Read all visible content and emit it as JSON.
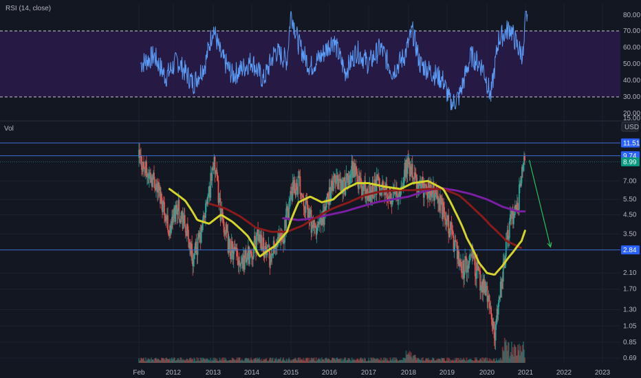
{
  "rsi_title": "RSI (14, close)",
  "vol_title": "Vol",
  "currency": "USD",
  "x_ticks": [
    "Feb",
    "2012",
    "2013",
    "2014",
    "2015",
    "2016",
    "2017",
    "2018",
    "2019",
    "2020",
    "2021",
    "2022",
    "2023"
  ],
  "colors": {
    "background": "#131722",
    "rsi_line": "#5b9cf6",
    "rsi_band": "#2a1a4a",
    "yellow_ma": "#d4d42b",
    "red_ma": "#8b1a1a",
    "purple_ma": "#7a1fa2",
    "level_line": "#3d6fd6",
    "arrow": "#22c55e",
    "candle_up": "#26a69a",
    "candle_down": "#ef5350"
  },
  "chart_data": [
    {
      "type": "line",
      "name": "RSI",
      "title": "RSI (14, close)",
      "ylim": [
        15,
        85
      ],
      "y_ticks": [
        80,
        70,
        60,
        50,
        40,
        30,
        20,
        15
      ],
      "bands": {
        "upper": 70,
        "lower": 30
      },
      "x": [
        2011.15,
        2011.5,
        2011.8,
        2012.1,
        2012.5,
        2012.8,
        2013.0,
        2013.2,
        2013.5,
        2013.8,
        2014.0,
        2014.3,
        2014.6,
        2014.9,
        2015.0,
        2015.2,
        2015.5,
        2015.8,
        2016.1,
        2016.4,
        2016.7,
        2017.0,
        2017.3,
        2017.6,
        2017.9,
        2018.1,
        2018.3,
        2018.6,
        2018.9,
        2019.1,
        2019.3,
        2019.6,
        2019.9,
        2020.1,
        2020.3,
        2020.6,
        2020.8,
        2020.95,
        2021.0,
        2021.05
      ],
      "values": [
        50,
        55,
        42,
        52,
        38,
        50,
        72,
        55,
        43,
        48,
        52,
        40,
        58,
        52,
        82,
        62,
        48,
        55,
        65,
        45,
        58,
        50,
        60,
        45,
        55,
        70,
        50,
        45,
        40,
        25,
        30,
        55,
        48,
        30,
        65,
        72,
        60,
        55,
        78,
        80
      ]
    },
    {
      "type": "line",
      "name": "Price",
      "title": "Vol",
      "yscale": "log",
      "ylim": [
        0.65,
        12.5
      ],
      "y_ticks": [
        11.51,
        9.74,
        8.99,
        7.0,
        5.5,
        4.5,
        3.5,
        2.84,
        2.1,
        1.7,
        1.3,
        1.05,
        0.85,
        0.69
      ],
      "price_tags": [
        {
          "value": 11.51,
          "label": "11.51",
          "color": "#2962ff"
        },
        {
          "value": 9.74,
          "label": "9.74",
          "color": "#2962ff"
        },
        {
          "value": 8.99,
          "label": "8.99",
          "color": "#089981"
        },
        {
          "value": 2.84,
          "label": "2.84",
          "color": "#2962ff"
        }
      ],
      "horizontal_levels": [
        11.51,
        9.74,
        2.84
      ],
      "series": [
        {
          "role": "candles",
          "x": [
            2011.1,
            2011.3,
            2011.5,
            2011.7,
            2011.9,
            2012.1,
            2012.3,
            2012.5,
            2012.7,
            2012.9,
            2013.0,
            2013.2,
            2013.4,
            2013.6,
            2013.8,
            2014.0,
            2014.2,
            2014.4,
            2014.6,
            2014.8,
            2015.0,
            2015.2,
            2015.4,
            2015.6,
            2015.8,
            2016.0,
            2016.2,
            2016.4,
            2016.6,
            2016.8,
            2017.0,
            2017.2,
            2017.4,
            2017.6,
            2017.8,
            2018.0,
            2018.2,
            2018.4,
            2018.6,
            2018.8,
            2019.0,
            2019.2,
            2019.4,
            2019.6,
            2019.8,
            2020.0,
            2020.2,
            2020.4,
            2020.6,
            2020.8,
            2021.0
          ],
          "values": [
            9.5,
            7.8,
            7.2,
            5.5,
            3.5,
            5.2,
            3.8,
            2.5,
            3.5,
            6.0,
            9.0,
            4.5,
            3.0,
            2.6,
            2.5,
            2.8,
            3.5,
            2.6,
            2.9,
            3.3,
            5.8,
            7.0,
            5.0,
            3.6,
            4.0,
            6.0,
            7.2,
            6.5,
            8.5,
            6.5,
            6.0,
            6.8,
            6.2,
            5.8,
            6.5,
            9.0,
            6.5,
            6.5,
            6.2,
            5.2,
            4.2,
            3.0,
            2.2,
            2.6,
            2.0,
            1.6,
            0.9,
            2.0,
            4.0,
            5.0,
            10.0
          ]
        },
        {
          "role": "ma-yellow",
          "x": [
            2011.9,
            2012.3,
            2012.6,
            2012.9,
            2013.2,
            2013.5,
            2013.9,
            2014.2,
            2014.6,
            2014.9,
            2015.2,
            2015.5,
            2015.8,
            2016.1,
            2016.4,
            2016.7,
            2017.0,
            2017.4,
            2017.8,
            2018.1,
            2018.5,
            2018.9,
            2019.2,
            2019.5,
            2019.8,
            2020.0,
            2020.2,
            2020.4,
            2020.7,
            2020.9,
            2021.0
          ],
          "values": [
            6.3,
            5.4,
            4.2,
            4.0,
            4.5,
            4.1,
            3.4,
            2.6,
            3.0,
            3.6,
            5.3,
            5.7,
            5.3,
            5.5,
            6.3,
            6.8,
            6.8,
            6.5,
            6.3,
            6.8,
            7.0,
            6.3,
            4.7,
            3.3,
            2.4,
            2.1,
            2.05,
            2.3,
            2.8,
            3.2,
            3.7
          ]
        },
        {
          "role": "ma-red",
          "x": [
            2012.9,
            2013.3,
            2013.7,
            2014.1,
            2014.5,
            2014.9,
            2015.3,
            2015.7,
            2016.1,
            2016.5,
            2016.9,
            2017.3,
            2017.7,
            2018.1,
            2018.5,
            2018.9,
            2019.3,
            2019.7,
            2020.1,
            2020.5,
            2020.9
          ],
          "values": [
            5.2,
            4.9,
            4.4,
            3.8,
            3.6,
            3.6,
            3.9,
            4.4,
            4.9,
            5.3,
            5.8,
            6.1,
            6.2,
            6.2,
            6.3,
            6.3,
            5.8,
            4.8,
            3.9,
            3.2,
            2.9
          ]
        },
        {
          "role": "ma-purple",
          "x": [
            2014.8,
            2015.2,
            2015.6,
            2016.0,
            2016.4,
            2016.8,
            2017.2,
            2017.6,
            2018.0,
            2018.4,
            2018.8,
            2019.2,
            2019.6,
            2020.0,
            2020.4,
            2020.8,
            2021.0
          ],
          "values": [
            4.3,
            4.2,
            4.3,
            4.5,
            4.7,
            5.0,
            5.3,
            5.5,
            5.7,
            6.1,
            6.4,
            6.2,
            5.9,
            5.5,
            5.0,
            4.7,
            4.7
          ]
        },
        {
          "role": "arrow",
          "x": [
            2021.1,
            2021.65
          ],
          "values": [
            9.2,
            2.95
          ]
        }
      ]
    }
  ]
}
